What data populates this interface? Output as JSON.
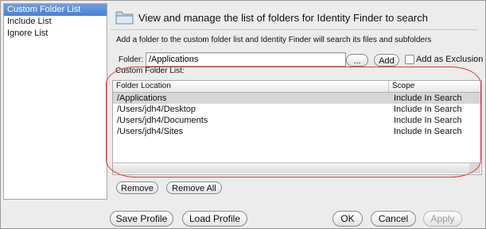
{
  "sidebar": {
    "items": [
      {
        "label": "Custom Folder List",
        "selected": true
      },
      {
        "label": "Include List",
        "selected": false
      },
      {
        "label": "Ignore List",
        "selected": false
      }
    ]
  },
  "header": {
    "icon": "folder-icon",
    "title": "View and manage the list of folders for Identity Finder to search"
  },
  "description": "Add a folder to the custom folder list and Identity Finder will search its files and subfolders",
  "folder_row": {
    "label": "Folder:",
    "value": "/Applications",
    "browse_label": "...",
    "add_label": "Add",
    "exclusion_label": "Add as Exclusion",
    "exclusion_checked": false
  },
  "list": {
    "title": "Custom Folder List:",
    "columns": [
      "Folder Location",
      "Scope"
    ],
    "rows": [
      {
        "location": "/Applications",
        "scope": "Include In Search",
        "selected": true
      },
      {
        "location": "/Users/jdh4/Desktop",
        "scope": "Include In Search",
        "selected": false
      },
      {
        "location": "/Users/jdh4/Documents",
        "scope": "Include In Search",
        "selected": false
      },
      {
        "location": "/Users/jdh4/Sites",
        "scope": "Include In Search",
        "selected": false
      }
    ]
  },
  "list_buttons": {
    "remove": "Remove",
    "remove_all": "Remove All"
  },
  "footer": {
    "save_profile": "Save Profile",
    "load_profile": "Load Profile",
    "ok": "OK",
    "cancel": "Cancel",
    "apply": "Apply"
  },
  "colors": {
    "selection": "#4a7fd0",
    "highlight": "#d9373b",
    "row_selected": "#d6d6d6"
  }
}
